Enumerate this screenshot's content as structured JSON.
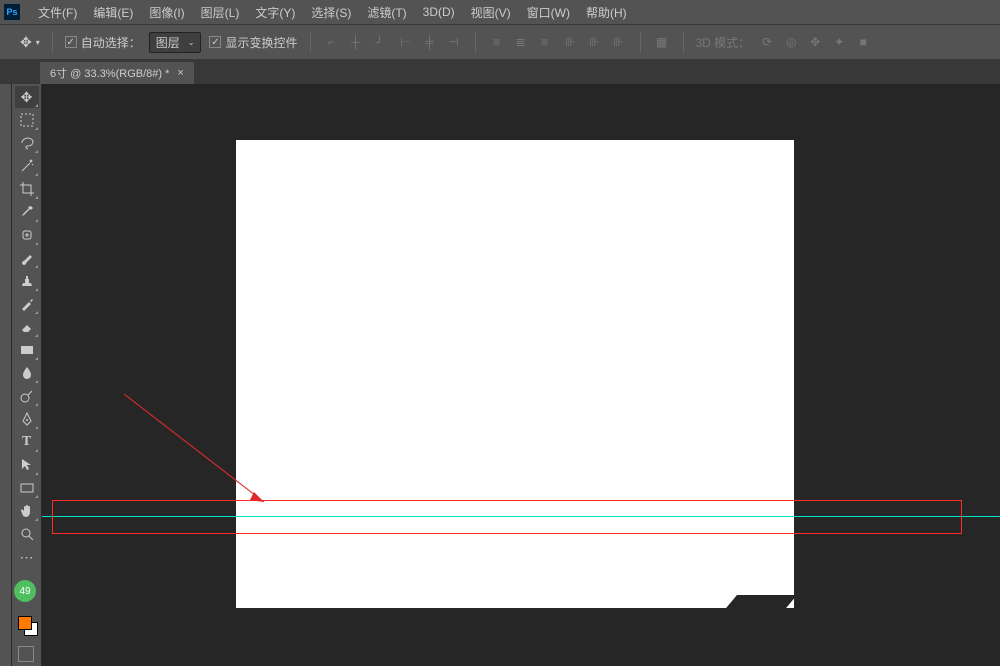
{
  "app": {
    "icon_label": "Ps"
  },
  "menu": {
    "file": "文件(F)",
    "edit": "编辑(E)",
    "image": "图像(I)",
    "layer": "图层(L)",
    "type": "文字(Y)",
    "select": "选择(S)",
    "filter": "滤镜(T)",
    "threed": "3D(D)",
    "view": "视图(V)",
    "window": "窗口(W)",
    "help": "帮助(H)"
  },
  "options": {
    "auto_select_label": "自动选择：",
    "auto_select_target": "图层",
    "show_transform_label": "显示变换控件",
    "threed_mode_label": "3D 模式："
  },
  "tab": {
    "title": "6寸 @ 33.3%(RGB/8#) *",
    "close": "×"
  },
  "badge": {
    "value": "49"
  }
}
